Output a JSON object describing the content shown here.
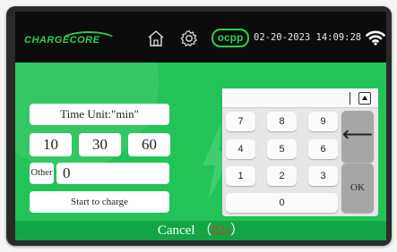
{
  "colors": {
    "accent_green": "#2ecf4a",
    "panel_green": "#22c457",
    "cancel_bar_green": "#14a644",
    "countdown_red": "#c0471e",
    "key_gray": "#a6a6a6"
  },
  "header": {
    "logo_text": "CHARGECORE",
    "home_icon": "home-icon",
    "settings_icon": "gear-icon",
    "ocpp_badge": "ocpp",
    "datetime": "02-20-2023 14:09:28",
    "wifi_icon": "wifi-icon"
  },
  "form": {
    "time_unit_label": "Time Unit:\"min\"",
    "presets": [
      "10",
      "30",
      "60"
    ],
    "other_label": "Other",
    "other_value": "0",
    "start_label": "Start to charge"
  },
  "keypad": {
    "display_value": "",
    "toggle_icon": "triangle-up-icon",
    "keys": [
      "7",
      "8",
      "9",
      "4",
      "5",
      "6",
      "1",
      "2",
      "3"
    ],
    "zero": "0",
    "backspace_label": "⟵",
    "ok_label": "OK"
  },
  "footer": {
    "cancel_label": "Cancel",
    "open_paren": "（",
    "countdown": "82s",
    "close_paren": "）"
  }
}
